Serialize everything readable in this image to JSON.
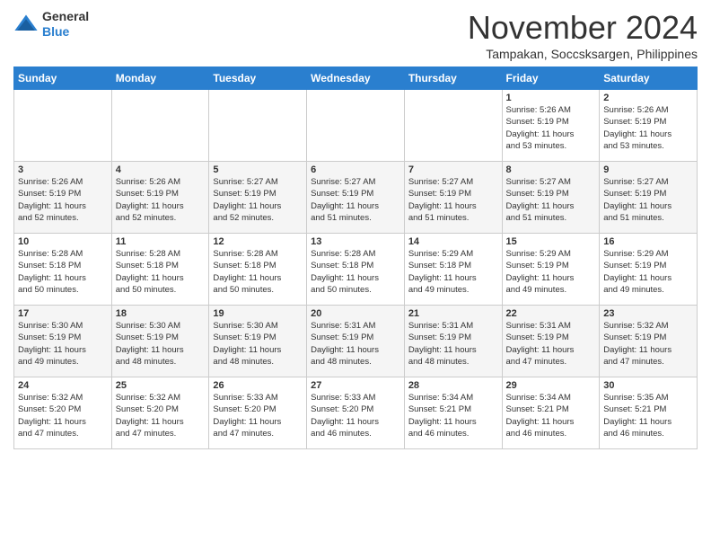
{
  "header": {
    "logo_line1": "General",
    "logo_line2": "Blue",
    "month_title": "November 2024",
    "location": "Tampakan, Soccsksargen, Philippines"
  },
  "weekdays": [
    "Sunday",
    "Monday",
    "Tuesday",
    "Wednesday",
    "Thursday",
    "Friday",
    "Saturday"
  ],
  "weeks": [
    [
      {
        "day": "",
        "text": ""
      },
      {
        "day": "",
        "text": ""
      },
      {
        "day": "",
        "text": ""
      },
      {
        "day": "",
        "text": ""
      },
      {
        "day": "",
        "text": ""
      },
      {
        "day": "1",
        "text": "Sunrise: 5:26 AM\nSunset: 5:19 PM\nDaylight: 11 hours\nand 53 minutes."
      },
      {
        "day": "2",
        "text": "Sunrise: 5:26 AM\nSunset: 5:19 PM\nDaylight: 11 hours\nand 53 minutes."
      }
    ],
    [
      {
        "day": "3",
        "text": "Sunrise: 5:26 AM\nSunset: 5:19 PM\nDaylight: 11 hours\nand 52 minutes."
      },
      {
        "day": "4",
        "text": "Sunrise: 5:26 AM\nSunset: 5:19 PM\nDaylight: 11 hours\nand 52 minutes."
      },
      {
        "day": "5",
        "text": "Sunrise: 5:27 AM\nSunset: 5:19 PM\nDaylight: 11 hours\nand 52 minutes."
      },
      {
        "day": "6",
        "text": "Sunrise: 5:27 AM\nSunset: 5:19 PM\nDaylight: 11 hours\nand 51 minutes."
      },
      {
        "day": "7",
        "text": "Sunrise: 5:27 AM\nSunset: 5:19 PM\nDaylight: 11 hours\nand 51 minutes."
      },
      {
        "day": "8",
        "text": "Sunrise: 5:27 AM\nSunset: 5:19 PM\nDaylight: 11 hours\nand 51 minutes."
      },
      {
        "day": "9",
        "text": "Sunrise: 5:27 AM\nSunset: 5:19 PM\nDaylight: 11 hours\nand 51 minutes."
      }
    ],
    [
      {
        "day": "10",
        "text": "Sunrise: 5:28 AM\nSunset: 5:18 PM\nDaylight: 11 hours\nand 50 minutes."
      },
      {
        "day": "11",
        "text": "Sunrise: 5:28 AM\nSunset: 5:18 PM\nDaylight: 11 hours\nand 50 minutes."
      },
      {
        "day": "12",
        "text": "Sunrise: 5:28 AM\nSunset: 5:18 PM\nDaylight: 11 hours\nand 50 minutes."
      },
      {
        "day": "13",
        "text": "Sunrise: 5:28 AM\nSunset: 5:18 PM\nDaylight: 11 hours\nand 50 minutes."
      },
      {
        "day": "14",
        "text": "Sunrise: 5:29 AM\nSunset: 5:18 PM\nDaylight: 11 hours\nand 49 minutes."
      },
      {
        "day": "15",
        "text": "Sunrise: 5:29 AM\nSunset: 5:19 PM\nDaylight: 11 hours\nand 49 minutes."
      },
      {
        "day": "16",
        "text": "Sunrise: 5:29 AM\nSunset: 5:19 PM\nDaylight: 11 hours\nand 49 minutes."
      }
    ],
    [
      {
        "day": "17",
        "text": "Sunrise: 5:30 AM\nSunset: 5:19 PM\nDaylight: 11 hours\nand 49 minutes."
      },
      {
        "day": "18",
        "text": "Sunrise: 5:30 AM\nSunset: 5:19 PM\nDaylight: 11 hours\nand 48 minutes."
      },
      {
        "day": "19",
        "text": "Sunrise: 5:30 AM\nSunset: 5:19 PM\nDaylight: 11 hours\nand 48 minutes."
      },
      {
        "day": "20",
        "text": "Sunrise: 5:31 AM\nSunset: 5:19 PM\nDaylight: 11 hours\nand 48 minutes."
      },
      {
        "day": "21",
        "text": "Sunrise: 5:31 AM\nSunset: 5:19 PM\nDaylight: 11 hours\nand 48 minutes."
      },
      {
        "day": "22",
        "text": "Sunrise: 5:31 AM\nSunset: 5:19 PM\nDaylight: 11 hours\nand 47 minutes."
      },
      {
        "day": "23",
        "text": "Sunrise: 5:32 AM\nSunset: 5:19 PM\nDaylight: 11 hours\nand 47 minutes."
      }
    ],
    [
      {
        "day": "24",
        "text": "Sunrise: 5:32 AM\nSunset: 5:20 PM\nDaylight: 11 hours\nand 47 minutes."
      },
      {
        "day": "25",
        "text": "Sunrise: 5:32 AM\nSunset: 5:20 PM\nDaylight: 11 hours\nand 47 minutes."
      },
      {
        "day": "26",
        "text": "Sunrise: 5:33 AM\nSunset: 5:20 PM\nDaylight: 11 hours\nand 47 minutes."
      },
      {
        "day": "27",
        "text": "Sunrise: 5:33 AM\nSunset: 5:20 PM\nDaylight: 11 hours\nand 46 minutes."
      },
      {
        "day": "28",
        "text": "Sunrise: 5:34 AM\nSunset: 5:21 PM\nDaylight: 11 hours\nand 46 minutes."
      },
      {
        "day": "29",
        "text": "Sunrise: 5:34 AM\nSunset: 5:21 PM\nDaylight: 11 hours\nand 46 minutes."
      },
      {
        "day": "30",
        "text": "Sunrise: 5:35 AM\nSunset: 5:21 PM\nDaylight: 11 hours\nand 46 minutes."
      }
    ]
  ]
}
